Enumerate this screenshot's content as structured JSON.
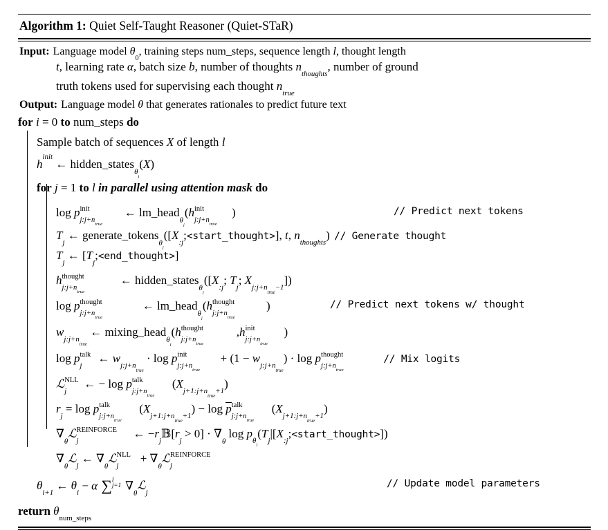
{
  "caption": {
    "label": "Algorithm 1:",
    "title": "Quiet Self-Taught Reasoner (Quiet-STaR)"
  },
  "io": {
    "input_label": "Input:",
    "input_line1": "Language model θ0, training steps num_steps, sequence length l, thought length",
    "input_line2": "t, learning rate α, batch size b, number of thoughts nthoughts, number of ground",
    "input_line3": "truth tokens used for supervising each thought ntrue",
    "output_label": "Output:",
    "output_text": "Language model θ that generates rationales to predict future text"
  },
  "keywords": {
    "for": "for",
    "to": "to",
    "do": "do",
    "return": "return",
    "in_parallel": "in parallel using attention mask"
  },
  "lines": {
    "outer_for": "for i = 0 to num_steps do",
    "sample_batch": "Sample batch of sequences X of length l",
    "h_init": "h^init ← hidden_states_θi(X)",
    "inner_for": "for j = 1 to l in parallel using attention mask do",
    "log_p_init": "log p^init_{j:j+ntrue} ← lm_head_θi(h^init_{j:j+ntrue})",
    "gen_tokens": "Tj ← generate_tokens_θi([X:j;<start_thought>], t, nthoughts)",
    "end_thought": "Tj ← [Tj;<end_thought>]",
    "h_thought": "h^thought_{j:j+ntrue} ← hidden_states_θi([X:j; Tj; Xj:j+ntrue−1])",
    "log_p_thought": "log p^thought_{j:j+ntrue} ← lm_head_θi(h^thought_{j:j+ntrue})",
    "mixing": "w_{j:j+ntrue} ← mixing_head_θi(h^thought_{j:j+ntrue}, h^init_{j:j+ntrue})",
    "log_p_talk": "log p^talk_j ← w_{j:j+ntrue} · log p^init_{j:j+ntrue} + (1 − w_{j:j+ntrue}) · log p^thought_{j:j+ntrue}",
    "nll": "L^NLL_j ← − log p^talk_{j:j+ntrue}(Xj+1:j+ntrue+1)",
    "reward": "rj = log p^talk_{j:j+ntrue}(Xj+1:j+ntrue+1) − log p̄^talk_{j:j+ntrue}(Xj+1:j+ntrue+1)",
    "reinforce": "∇θL^REINFORCE_j ← −rj𝟙[rj > 0] · ∇θ log pθi(Tj|[X:j;<start_thought>])",
    "grad_total": "∇θLj ← ∇θL^NLL_j + ∇θL^REINFORCE_j",
    "update": "θi+1 ← θi − α Σ^l_{j=1} ∇θLj",
    "return": "return θnum_steps"
  },
  "tokens": {
    "start_thought": "<start_thought>",
    "end_thought": "<end_thought>"
  },
  "comments": {
    "predict_next_tokens": "// Predict next tokens",
    "generate_thought": "// Generate thought",
    "predict_next_tokens_w_thought": "// Predict next tokens w/ thought",
    "mix_logits": "// Mix logits",
    "update_model_parameters": "// Update model parameters"
  },
  "symbols": {
    "arrow": "←",
    "theta": "θ",
    "alpha": "α",
    "nabla": "∇",
    "sigma": "∑",
    "minus": "−",
    "cdot": "·",
    "indicator": "𝟙",
    "script_l": "ℒ"
  },
  "colors": {
    "background": "#ffffff",
    "text": "#000000",
    "rule": "#000000"
  }
}
